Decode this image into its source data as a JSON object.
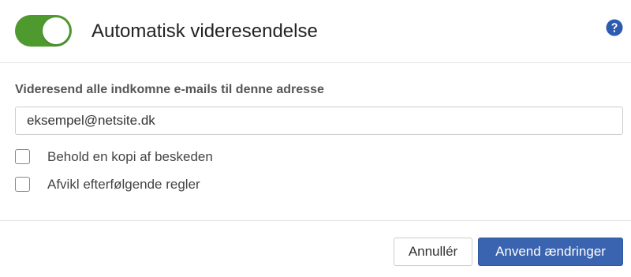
{
  "header": {
    "toggle_state": "on",
    "title": "Automatisk videresendelse",
    "help_icon": "question-circle-icon",
    "accent_color": "#4f9a2f",
    "help_color": "#2d5bb0"
  },
  "form": {
    "field_label": "Videresend alle indkomne e-mails til denne adresse",
    "email_value": "eksempel@netsite.dk",
    "options": [
      {
        "label": "Behold en kopi af beskeden",
        "checked": false
      },
      {
        "label": "Afvikl efterfølgende regler",
        "checked": false
      }
    ]
  },
  "footer": {
    "cancel_label": "Annullér",
    "apply_label": "Anvend ændringer",
    "apply_color": "#3a63b0"
  }
}
